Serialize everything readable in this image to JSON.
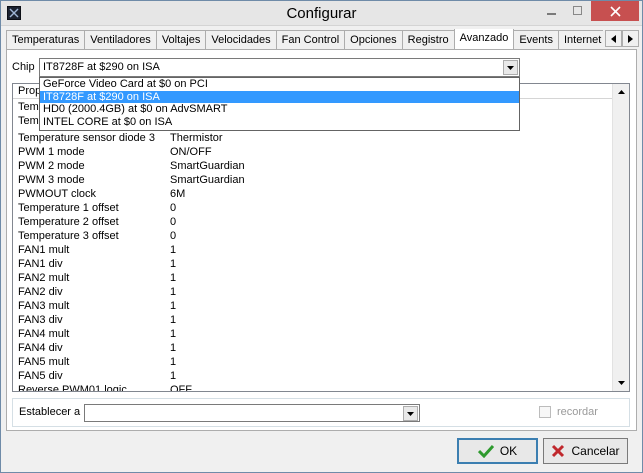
{
  "window": {
    "title": "Configurar"
  },
  "tabs": [
    {
      "label": "Temperaturas"
    },
    {
      "label": "Ventiladores"
    },
    {
      "label": "Voltajes"
    },
    {
      "label": "Velocidades"
    },
    {
      "label": "Fan Control"
    },
    {
      "label": "Opciones"
    },
    {
      "label": "Registro"
    },
    {
      "label": "Avanzado"
    },
    {
      "label": "Events"
    },
    {
      "label": "Internet"
    }
  ],
  "active_tab": "Avanzado",
  "chip": {
    "label": "Chip",
    "value": "IT8728F at $290 on ISA",
    "options": [
      "GeForce Video Card at $0 on PCI",
      "IT8728F at $290 on ISA",
      "HD0 (2000.4GB) at $0 on AdvSMART",
      "INTEL CORE at $0 on ISA"
    ],
    "selected_index": 1
  },
  "list": {
    "header_property": "Prop",
    "partial_rows": [
      "Tem",
      "Tem"
    ],
    "rows": [
      {
        "key": "Temperature sensor diode 3",
        "value": "Thermistor"
      },
      {
        "key": "PWM 1 mode",
        "value": "ON/OFF"
      },
      {
        "key": "PWM 2 mode",
        "value": "SmartGuardian"
      },
      {
        "key": "PWM 3 mode",
        "value": "SmartGuardian"
      },
      {
        "key": "PWMOUT clock",
        "value": "6M"
      },
      {
        "key": "Temperature 1 offset",
        "value": "0"
      },
      {
        "key": "Temperature 2 offset",
        "value": "0"
      },
      {
        "key": "Temperature 3 offset",
        "value": "0"
      },
      {
        "key": "FAN1 mult",
        "value": "1"
      },
      {
        "key": "FAN1 div",
        "value": "1"
      },
      {
        "key": "FAN2 mult",
        "value": "1"
      },
      {
        "key": "FAN2 div",
        "value": "1"
      },
      {
        "key": "FAN3 mult",
        "value": "1"
      },
      {
        "key": "FAN3 div",
        "value": "1"
      },
      {
        "key": "FAN4 mult",
        "value": "1"
      },
      {
        "key": "FAN4 div",
        "value": "1"
      },
      {
        "key": "FAN5 mult",
        "value": "1"
      },
      {
        "key": "FAN5 div",
        "value": "1"
      },
      {
        "key": "Reverse PWM01 logic",
        "value": "OFF"
      }
    ]
  },
  "establecer": {
    "label": "Establecer a",
    "value": ""
  },
  "recordar": {
    "label": "recordar",
    "checked": false
  },
  "buttons": {
    "ok": "OK",
    "cancel": "Cancelar"
  }
}
